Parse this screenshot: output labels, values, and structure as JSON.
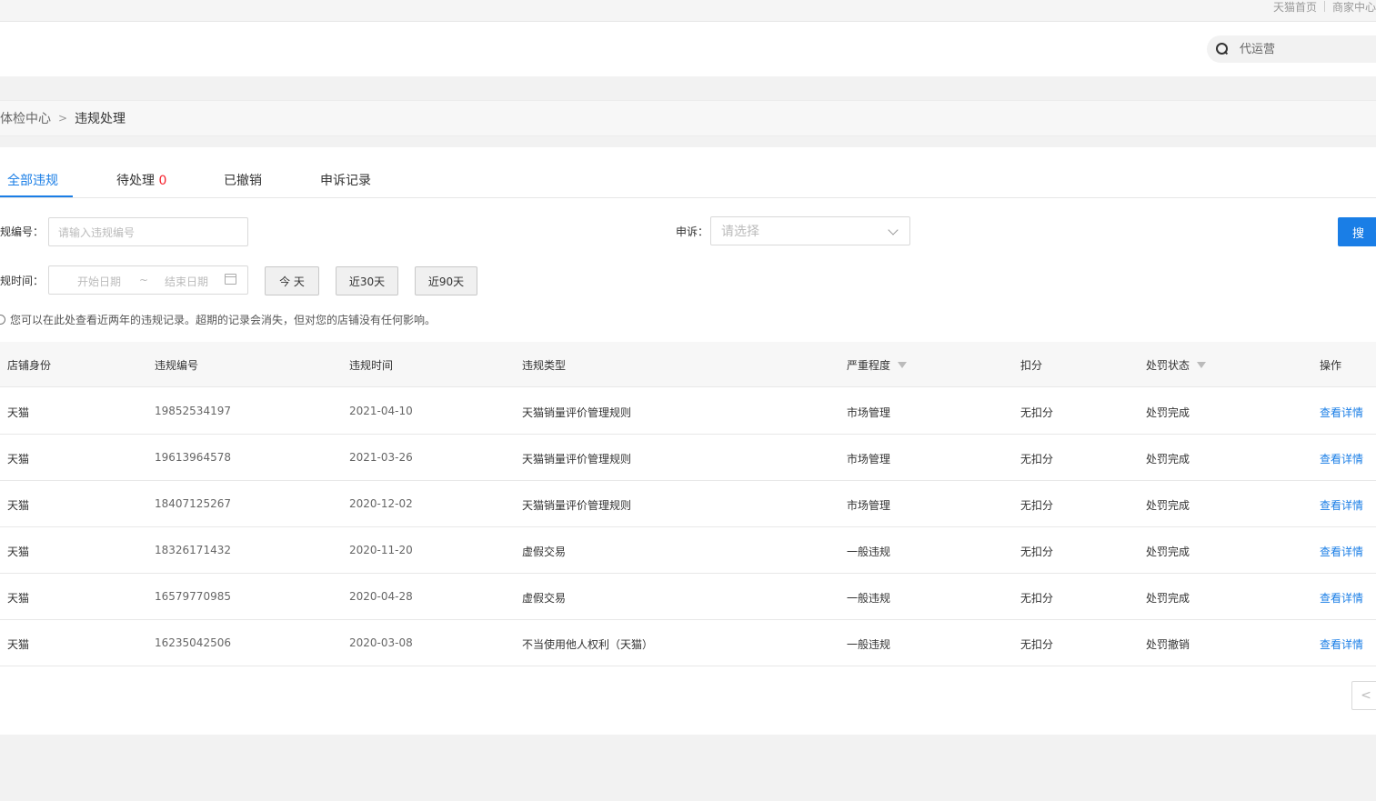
{
  "top_links": [
    "天猫首页",
    "商家中心"
  ],
  "header": {
    "search_placeholder": "代运营"
  },
  "breadcrumb": {
    "parent": "体检中心",
    "separator": ">",
    "current": "违规处理"
  },
  "tabs": [
    {
      "label": "全部违规",
      "count": ""
    },
    {
      "label": "待处理",
      "count": "0"
    },
    {
      "label": "已撤销",
      "count": ""
    },
    {
      "label": "申诉记录",
      "count": ""
    }
  ],
  "filters": {
    "id_label": "违规编号：",
    "id_placeholder": "请输入违规编号",
    "appeal_label": "申诉：",
    "appeal_placeholder": "请选择",
    "search_button": "搜 索",
    "time_label": "违规时间：",
    "start_placeholder": "开始日期",
    "range_sep": "~",
    "end_placeholder": "结束日期",
    "quick": [
      "今 天",
      "近30天",
      "近90天"
    ]
  },
  "tip": "您可以在此处查看近两年的违规记录。超期的记录会消失，但对您的店铺没有任何影响。",
  "table": {
    "columns": [
      "店铺身份",
      "违规编号",
      "违规时间",
      "违规类型",
      "严重程度",
      "扣分",
      "处罚状态",
      "操作"
    ],
    "rows": [
      [
        "天猫",
        "19852534197",
        "2021-04-10",
        "天猫销量评价管理规则",
        "市场管理",
        "无扣分",
        "处罚完成",
        "查看详情"
      ],
      [
        "天猫",
        "19613964578",
        "2021-03-26",
        "天猫销量评价管理规则",
        "市场管理",
        "无扣分",
        "处罚完成",
        "查看详情"
      ],
      [
        "天猫",
        "18407125267",
        "2020-12-02",
        "天猫销量评价管理规则",
        "市场管理",
        "无扣分",
        "处罚完成",
        "查看详情"
      ],
      [
        "天猫",
        "18326171432",
        "2020-11-20",
        "虚假交易",
        "一般违规",
        "无扣分",
        "处罚完成",
        "查看详情"
      ],
      [
        "天猫",
        "16579770985",
        "2020-04-28",
        "虚假交易",
        "一般违规",
        "无扣分",
        "处罚完成",
        "查看详情"
      ],
      [
        "天猫",
        "16235042506",
        "2020-03-08",
        "不当使用他人权利（天猫）",
        "一般违规",
        "无扣分",
        "处罚撤销",
        "查看详情"
      ]
    ]
  },
  "pager": {
    "prev": "<"
  },
  "colors": {
    "accent": "#1a7ee6",
    "count": "#f5222d"
  }
}
